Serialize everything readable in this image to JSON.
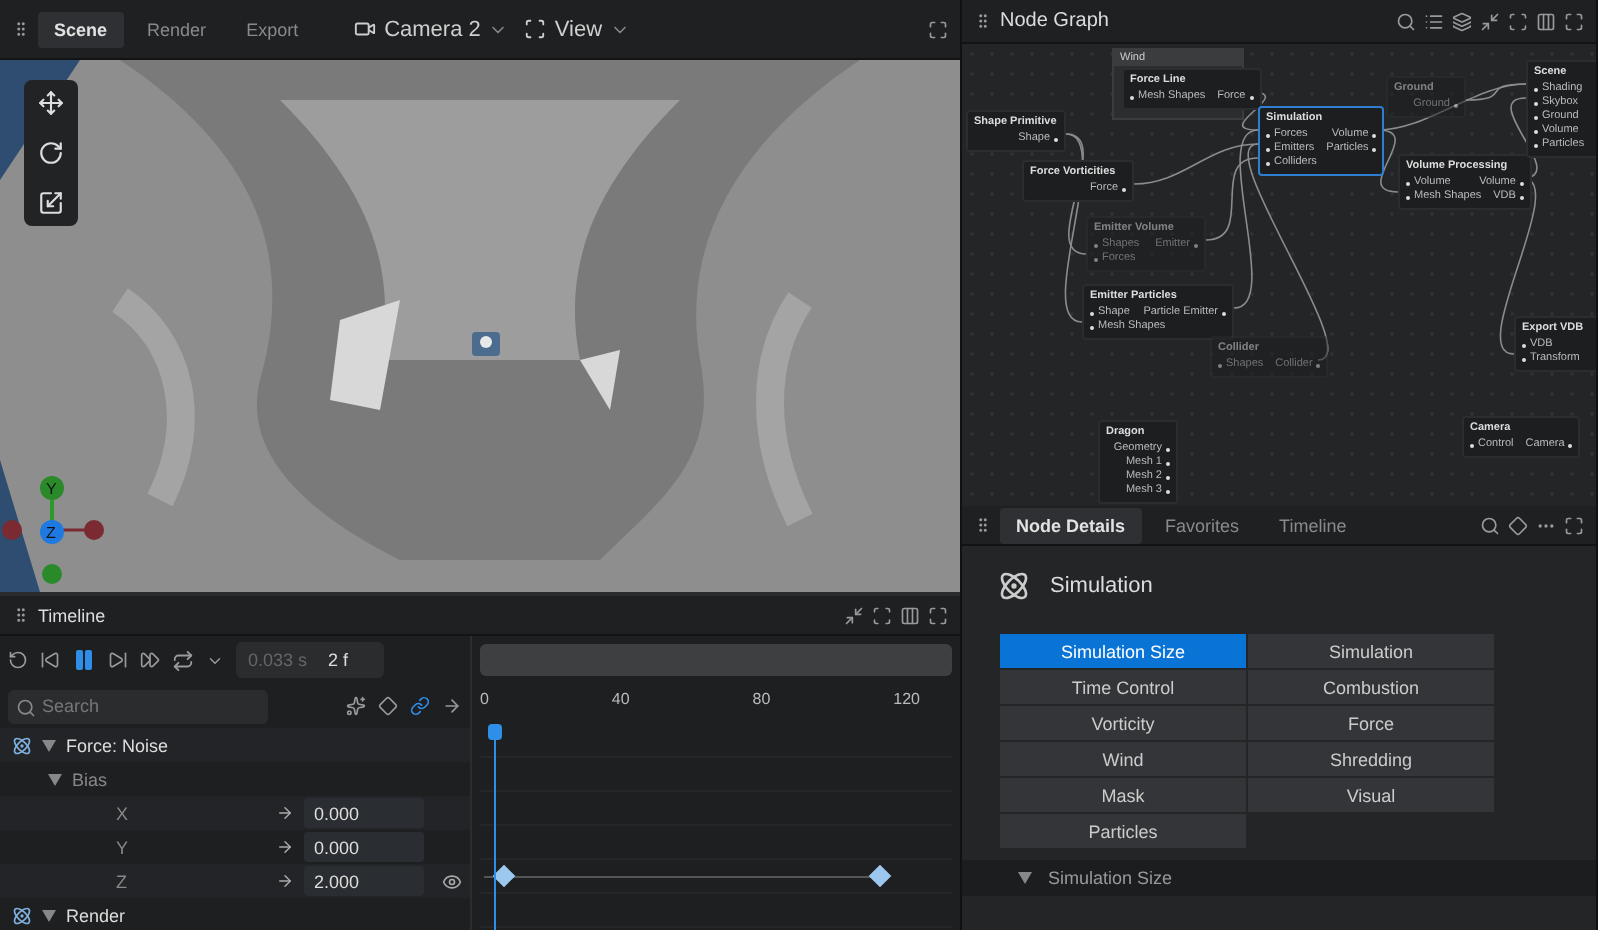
{
  "viewport": {
    "tabs": [
      {
        "label": "Scene",
        "selected": true
      },
      {
        "label": "Render",
        "selected": false
      },
      {
        "label": "Export",
        "selected": false
      }
    ],
    "camera": "Camera 2",
    "view": "View",
    "gizmo_axes": [
      "Y",
      "Z"
    ]
  },
  "node_graph": {
    "title": "Node Graph",
    "group": "Wind",
    "nodes": [
      {
        "title": "Force Line",
        "inputs": [
          "Mesh Shapes"
        ],
        "outputs": [
          "Force"
        ],
        "selected": false,
        "disabled": false
      },
      {
        "title": "Shape Primitive",
        "outputs": [
          "Shape"
        ],
        "selected": false,
        "disabled": false
      },
      {
        "title": "Force Vorticities",
        "outputs": [
          "Force"
        ],
        "selected": false,
        "disabled": false
      },
      {
        "title": "Simulation",
        "inputs": [
          "Forces",
          "Emitters",
          "Colliders"
        ],
        "outputs": [
          "Volume",
          "Particles"
        ],
        "selected": true,
        "disabled": false
      },
      {
        "title": "Volume Processing",
        "inputs": [
          "Volume",
          "Mesh Shapes"
        ],
        "outputs": [
          "Volume",
          "VDB"
        ],
        "selected": false,
        "disabled": false
      },
      {
        "title": "Scene",
        "inputs": [
          "Shading",
          "Skybox",
          "Ground",
          "Volume",
          "Particles"
        ],
        "selected": false,
        "disabled": false
      },
      {
        "title": "Ground",
        "outputs": [
          "Ground"
        ],
        "selected": false,
        "disabled": true
      },
      {
        "title": "Emitter Volume",
        "inputs": [
          "Shapes",
          "Forces"
        ],
        "outputs": [
          "Emitter"
        ],
        "selected": false,
        "disabled": true
      },
      {
        "title": "Emitter Particles",
        "inputs": [
          "Shape",
          "Mesh Shapes"
        ],
        "outputs": [
          "Particle Emitter"
        ],
        "selected": false,
        "disabled": false
      },
      {
        "title": "Collider",
        "inputs": [
          "Shapes"
        ],
        "outputs": [
          "Collider"
        ],
        "selected": false,
        "disabled": true
      },
      {
        "title": "Export VDB",
        "inputs": [
          "VDB",
          "Transform"
        ],
        "selected": false,
        "disabled": false
      },
      {
        "title": "Dragon",
        "outputs": [
          "Geometry",
          "Mesh 1",
          "Mesh 2",
          "Mesh 3"
        ],
        "selected": false,
        "disabled": false
      },
      {
        "title": "Camera",
        "inputs": [
          "Control"
        ],
        "outputs": [
          "Camera"
        ],
        "selected": false,
        "disabled": false
      }
    ]
  },
  "timeline": {
    "title": "Timeline",
    "playing": true,
    "time": "0.033 s",
    "frame": "2 f",
    "search": {
      "placeholder": "Search"
    },
    "ruler": [
      "0",
      "40",
      "80",
      "120"
    ],
    "playhead": {
      "level": 0.02
    },
    "tracks": [
      {
        "label": "Force: Noise",
        "expanded": true,
        "children": [
          {
            "label": "Bias",
            "expanded": true,
            "children": [
              {
                "label": "X",
                "value": "0.000",
                "keyed": false
              },
              {
                "label": "Y",
                "value": "0.000",
                "keyed": false
              },
              {
                "label": "Z",
                "value": "2.000",
                "keyed": true
              }
            ]
          }
        ]
      },
      {
        "label": "Render",
        "expanded": true
      }
    ]
  },
  "details": {
    "tabs": [
      {
        "label": "Node Details",
        "selected": true
      },
      {
        "label": "Favorites",
        "selected": false
      },
      {
        "label": "Timeline",
        "selected": false
      }
    ],
    "heading": "Simulation",
    "sections": [
      {
        "label": "Simulation Size",
        "selected": true
      },
      {
        "label": "Simulation",
        "selected": false
      },
      {
        "label": "Time Control",
        "selected": false
      },
      {
        "label": "Combustion",
        "selected": false
      },
      {
        "label": "Vorticity",
        "selected": false
      },
      {
        "label": "Force",
        "selected": false
      },
      {
        "label": "Wind",
        "selected": false
      },
      {
        "label": "Shredding",
        "selected": false
      },
      {
        "label": "Mask",
        "selected": false
      },
      {
        "label": "Visual",
        "selected": false
      },
      {
        "label": "Particles",
        "selected": false
      }
    ],
    "panel": {
      "label": "Simulation Size",
      "expanded": true
    }
  }
}
